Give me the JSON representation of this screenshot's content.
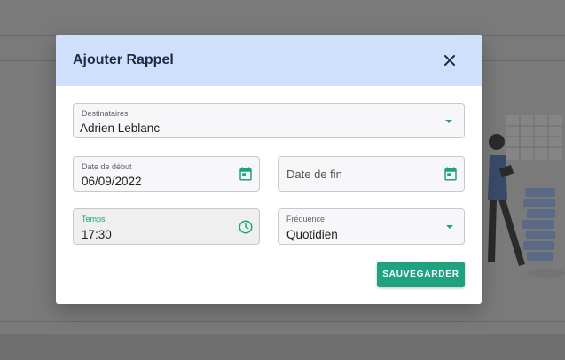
{
  "modal": {
    "title": "Ajouter Rappel",
    "close_icon": "close-icon"
  },
  "form": {
    "destinataires": {
      "label": "Destinataires",
      "value": "Adrien Leblanc"
    },
    "date_debut": {
      "label": "Date de début",
      "value": "06/09/2022",
      "icon": "calendar-icon"
    },
    "date_fin": {
      "placeholder": "Date de fin",
      "icon": "calendar-icon"
    },
    "temps": {
      "label": "Temps",
      "value": "17:30",
      "icon": "clock-icon"
    },
    "frequence": {
      "label": "Fréquence",
      "value": "Quotidien"
    }
  },
  "actions": {
    "save_label": "SAUVEGARDER"
  },
  "colors": {
    "accent": "#1ea27f",
    "header_bg": "#cfe0fc",
    "title_text": "#1f2a44"
  }
}
